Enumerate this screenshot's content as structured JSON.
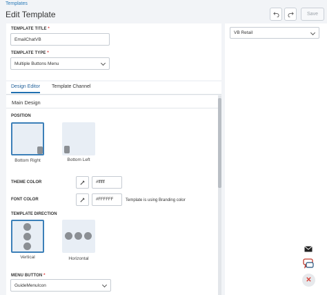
{
  "breadcrumb": "Templates",
  "page_title": "Edit Template",
  "toolbar": {
    "save_label": "Save"
  },
  "form": {
    "title_label": "TEMPLATE TITLE",
    "title_value": "EmailChatVB",
    "type_label": "TEMPLATE TYPE",
    "type_value": "Multiple Buttons Menu",
    "required_mark": "*"
  },
  "tabs": [
    {
      "label": "Design Editor",
      "active": true
    },
    {
      "label": "Template Channel",
      "active": false
    }
  ],
  "design": {
    "section_title": "Main Design",
    "position_label": "POSITION",
    "position_options": [
      {
        "label": "Bottom Right",
        "selected": true
      },
      {
        "label": "Bottom Left",
        "selected": false
      }
    ],
    "theme_color_label": "THEME COLOR",
    "theme_color_value": "#ffffff",
    "font_color_label": "FONT COLOR",
    "font_color_value": "#FFFFFF",
    "font_color_note": "Template is using Branding color",
    "direction_label": "TEMPLATE DIRECTION",
    "direction_options": [
      {
        "label": "Vertical",
        "selected": true
      },
      {
        "label": "Horizontal",
        "selected": false
      }
    ],
    "menu_button_label": "MENU BUTTON",
    "menu_button_value": "GuideMenuIcon"
  },
  "preview": {
    "brand_select_value": "VB Retail",
    "icons": [
      "mail-icon",
      "chat-icon",
      "close-icon"
    ]
  },
  "colors": {
    "accent": "#1f6fb0",
    "selected_border": "#3b7fb8",
    "close_red": "#d9443a"
  }
}
